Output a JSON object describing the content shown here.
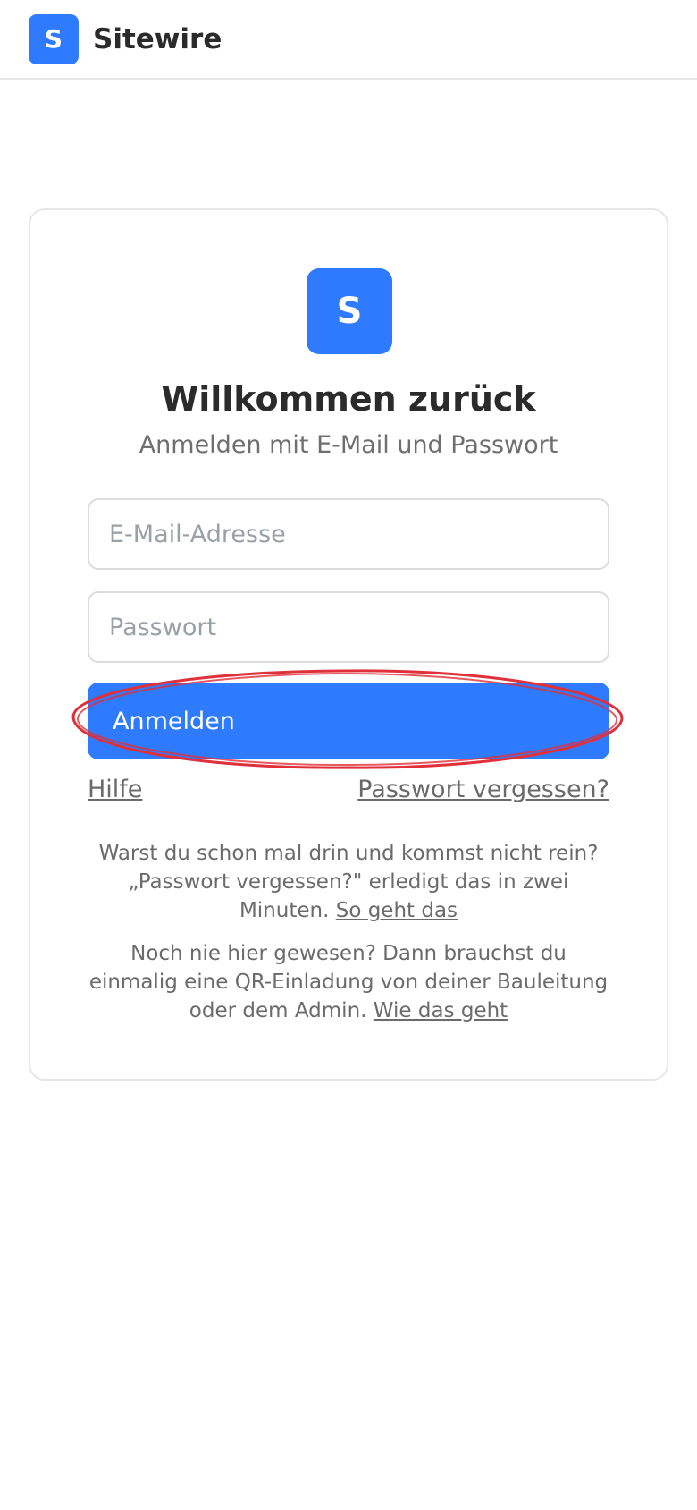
{
  "header": {
    "logo_letter": "S",
    "brand": "Sitewire"
  },
  "card": {
    "logo_letter": "S",
    "title": "Willkommen zurück",
    "subtitle": "Anmelden mit E-Mail und Passwort"
  },
  "form": {
    "email_placeholder": "E-Mail-Adresse",
    "email_value": "",
    "password_placeholder": "Passwort",
    "password_value": "",
    "submit_label": "Anmelden"
  },
  "links": {
    "help": "Hilfe",
    "forgot_password": "Passwort vergessen?"
  },
  "info": {
    "returning_text": "Warst du schon mal drin und kommst nicht rein? „Passwort vergessen?\" erledigt das in zwei Minuten.",
    "returning_link": "So geht das",
    "new_text": "Noch nie hier gewesen? Dann brauchst du einmalig eine QR-Einladung von deiner Bauleitung oder dem Admin.",
    "new_link": "Wie das geht"
  },
  "colors": {
    "accent": "#2f7bff",
    "annotation": "#e0303a"
  }
}
